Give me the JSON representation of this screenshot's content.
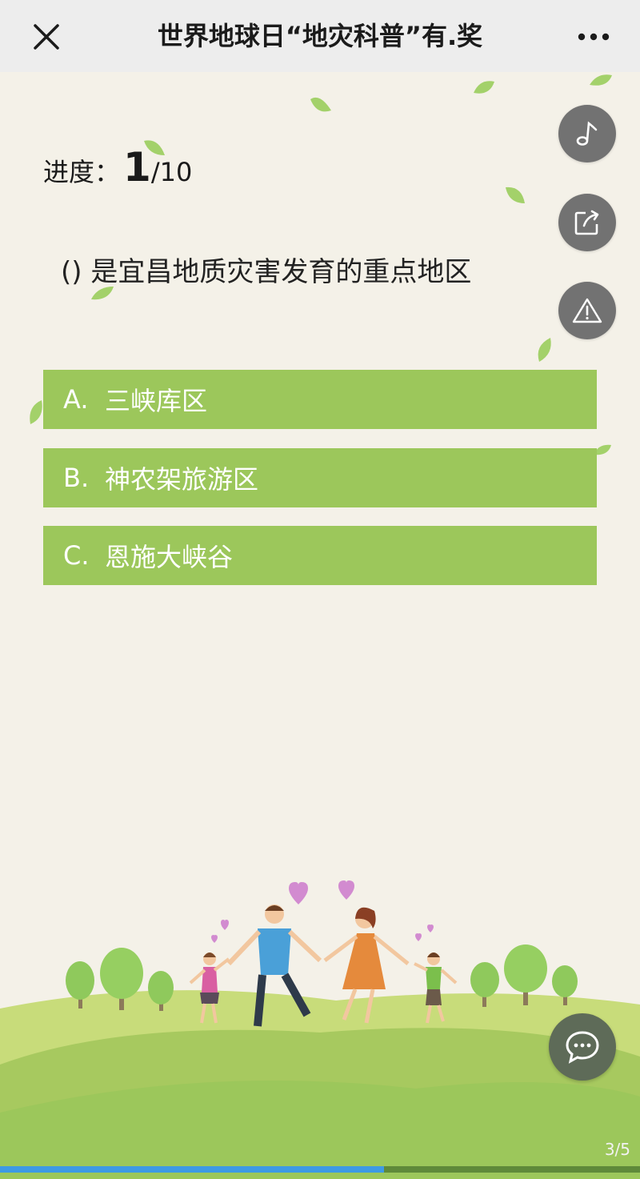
{
  "titlebar": {
    "title": "世界地球日“地灾科普”有.奖",
    "close_icon": "close-icon",
    "more_icon": "more-icon"
  },
  "side_buttons": {
    "music_icon": "music-note-icon",
    "share_icon": "share-icon",
    "report_icon": "warning-icon"
  },
  "quiz": {
    "progress_label": "进度：",
    "progress_current": "1",
    "progress_total": "/10",
    "question": "()  是宜昌地质灾害发育的重点地区",
    "options": [
      {
        "letter": "A.",
        "text": "三峡库区"
      },
      {
        "letter": "B.",
        "text": "神农架旅游区"
      },
      {
        "letter": "C.",
        "text": "恩施大峡谷"
      }
    ]
  },
  "footer": {
    "page_indicator": "3/5",
    "page_progress": 0.6,
    "chat_icon": "chat-bubble-icon"
  },
  "colors": {
    "option_bg": "#9cc75b",
    "page_bg": "#f4f1e8",
    "titlebar_bg": "#ededed",
    "progress_bar": "#3e9ae4"
  }
}
